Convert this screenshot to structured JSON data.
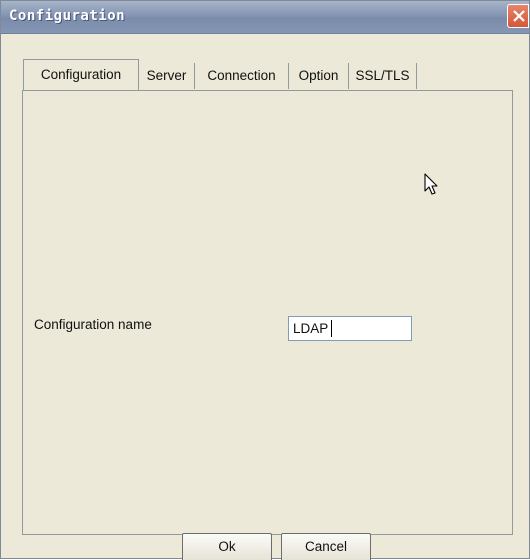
{
  "window": {
    "title": "Configuration"
  },
  "tabs": [
    {
      "label": "Configuration",
      "active": true
    },
    {
      "label": "Server",
      "active": false
    },
    {
      "label": "Connection",
      "active": false
    },
    {
      "label": "Option",
      "active": false
    },
    {
      "label": "SSL/TLS",
      "active": false
    }
  ],
  "form": {
    "config_name_label": "Configuration name",
    "config_name_value": "LDAP"
  },
  "buttons": {
    "ok_label": "Ok",
    "cancel_label": "Cancel"
  },
  "icons": {
    "close": "close-icon",
    "cursor": "mouse-pointer-icon"
  },
  "colors": {
    "titlebar": "#8495b3",
    "close_button": "#d4573a",
    "dialog_background": "#ece9d8"
  }
}
